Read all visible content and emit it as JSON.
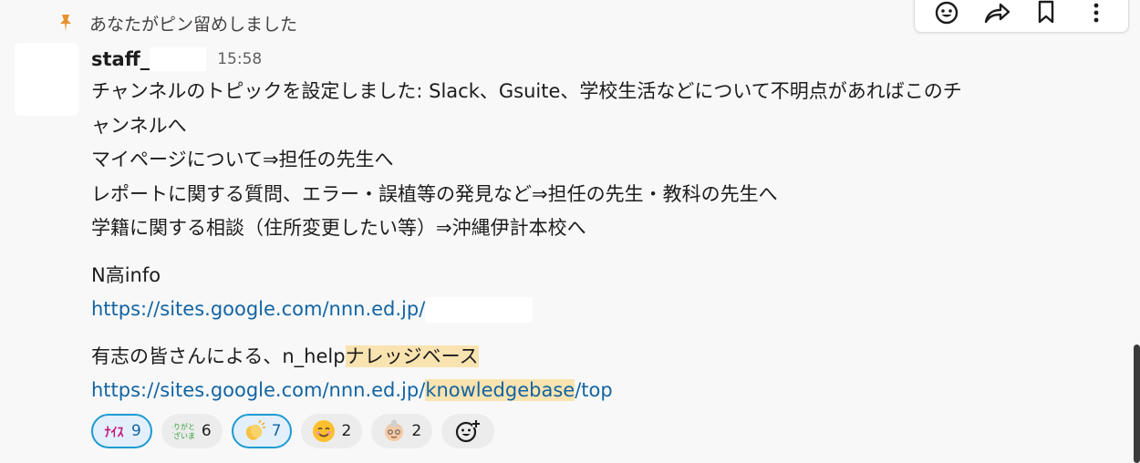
{
  "pin_notice": "あなたがピン留めしました",
  "message": {
    "sender": "staff_",
    "time": "15:58",
    "lines": [
      "チャンネルのトピックを設定しました: Slack、Gsuite、学校生活などについて不明点があればこのチ",
      "ャンネルへ",
      "マイページについて⇒担任の先生へ",
      "レポートに関する質問、エラー・誤植等の発見など⇒担任の先生・教科の先生へ",
      "学籍に関する相談（住所変更したい等）⇒沖縄伊計本校へ"
    ],
    "info_title": "N高info",
    "info_link": "https://sites.google.com/nnn.ed.jp/",
    "kb_prefix": "有志の皆さんによる、n_help",
    "kb_highlight": "ナレッジベース",
    "kb_link_prefix": "https://sites.google.com/nnn.ed.jp/",
    "kb_link_highlight": "knowledgebase",
    "kb_link_suffix": "/top"
  },
  "reactions": [
    {
      "name": "nice-emoji",
      "glyph": "ﾅｲｽ",
      "count": "9",
      "active": true
    },
    {
      "name": "arigatou-emoji",
      "glyph": "ありがとうございます",
      "count": "6",
      "active": false
    },
    {
      "name": "clap-emoji",
      "glyph": "👏",
      "count": "7",
      "active": true
    },
    {
      "name": "smile-emoji",
      "glyph": "😊",
      "count": "2",
      "active": false
    },
    {
      "name": "grandma-emoji",
      "glyph": "👵",
      "count": "2",
      "active": false
    }
  ],
  "colors": {
    "link": "#1264a3",
    "highlight": "#f9e3b0",
    "pin": "#e8912d",
    "active_reaction_border": "#1d9bd1"
  }
}
